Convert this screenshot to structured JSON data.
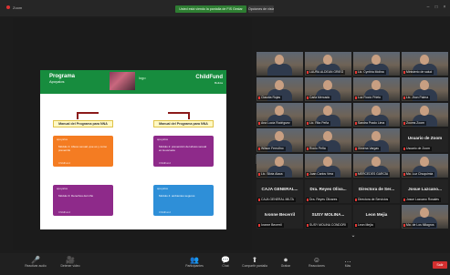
{
  "window": {
    "app_title": "Zoom",
    "share_banner": "Usted está viendo la pantalla de FIS Gestar",
    "view_options": "Opciones de vista"
  },
  "slide": {
    "brand_left_big": "Programa",
    "brand_left": "Apoyalos",
    "brand_mid": "logo",
    "brand_right": "ChildFund",
    "brand_right_sub": "Bolivia",
    "manual_left": "Manual del Programa para NNA",
    "manual_right": "Manual del Programa para NNA",
    "cards": [
      {
        "logo": "apoyalos",
        "text": "Módulo 1: Abuso sexual, que es y como prevenirlo",
        "sub": "ChildFund",
        "color": "#f47c22"
      },
      {
        "logo": "apoyalos",
        "text": "Módulo 2: prevención del abuso sexual en la escuela",
        "sub": "ChildFund",
        "color": "#8e2a8a"
      },
      {
        "logo": "apoyalos",
        "text": "Módulo 3: Derechos del niño",
        "sub": "ChildFund",
        "color": "#8e2a8a"
      },
      {
        "logo": "apoyalos",
        "text": "Módulo 4: ambientes seguros",
        "sub": "ChildFund",
        "color": "#2e8fd8"
      }
    ]
  },
  "participants": [
    {
      "label": "",
      "video": true
    },
    {
      "label": "LAURA ALDEAN GRIEG",
      "video": true
    },
    {
      "label": "Lic. Cynthia Molina",
      "video": true
    },
    {
      "label": "Ministerio de salud",
      "video": true
    },
    {
      "label": "Claudia Rojas",
      "video": true
    },
    {
      "label": "Carla Mercado",
      "video": true
    },
    {
      "label": "Luz Rocío Prieto",
      "video": true
    },
    {
      "label": "Lic. Jhon Palma",
      "video": true
    },
    {
      "label": "Ana Lucía Rodriguez",
      "video": true
    },
    {
      "label": "Lic. Rita Peña",
      "video": true
    },
    {
      "label": "Sandra Prado Lima",
      "video": true
    },
    {
      "label": "Zooms Zoom",
      "video": true
    },
    {
      "label": "Wilson Ferrufino",
      "video": true
    },
    {
      "label": "Rocío Peña",
      "video": true
    },
    {
      "label": "Ximena Vargas",
      "video": true
    },
    {
      "label": "Usuario de Zoom",
      "name": "Usuario de Zoom",
      "video": false
    },
    {
      "label": "Lic. Silvia Alaca",
      "video": true
    },
    {
      "label": "Juan Carlos Vera",
      "video": true
    },
    {
      "label": "MERCEDES GARCÍA",
      "video": true
    },
    {
      "label": "Ma. Luz Chuquimia",
      "video": true
    },
    {
      "label": "CAJA GENERAL MILTA",
      "name": "CAJA GENERAL...",
      "video": false
    },
    {
      "label": "Dra. Reyes Olivares",
      "name": "Dra. Reyes Oliva...",
      "video": false
    },
    {
      "label": "Directora de Servicios",
      "name": "Directora de Ser...",
      "video": false
    },
    {
      "label": "Josue Lazcano Rosales",
      "name": "Josue Lazcano...",
      "video": false
    },
    {
      "label": "Ivonne Becerril",
      "name": "Ivonne Becerril",
      "video": false
    },
    {
      "label": "SUSY MOLINA CONDORI",
      "name": "SUSY MOLINA...",
      "video": false
    },
    {
      "label": "Leon Mejia",
      "name": "Leon Mejia",
      "video": false
    },
    {
      "label": "Ma. de Los Milagros",
      "video": true
    }
  ],
  "toolbar": {
    "items": [
      {
        "icon": "mic-icon",
        "glyph": "🎤",
        "label": "Reactivar audio"
      },
      {
        "icon": "video-icon",
        "glyph": "🎥",
        "label": "Detener video"
      },
      {
        "icon": "participants-icon",
        "glyph": "👥",
        "label": "Participantes"
      },
      {
        "icon": "chat-icon",
        "glyph": "💬",
        "label": "Chat"
      },
      {
        "icon": "share-icon",
        "glyph": "⬆",
        "label": "Compartir pantalla"
      },
      {
        "icon": "record-icon",
        "glyph": "⏺",
        "label": "Grabar"
      },
      {
        "icon": "reactions-icon",
        "glyph": "☺",
        "label": "Reacciones"
      },
      {
        "icon": "more-icon",
        "glyph": "…",
        "label": "Más"
      }
    ],
    "end_label": "Salir"
  }
}
